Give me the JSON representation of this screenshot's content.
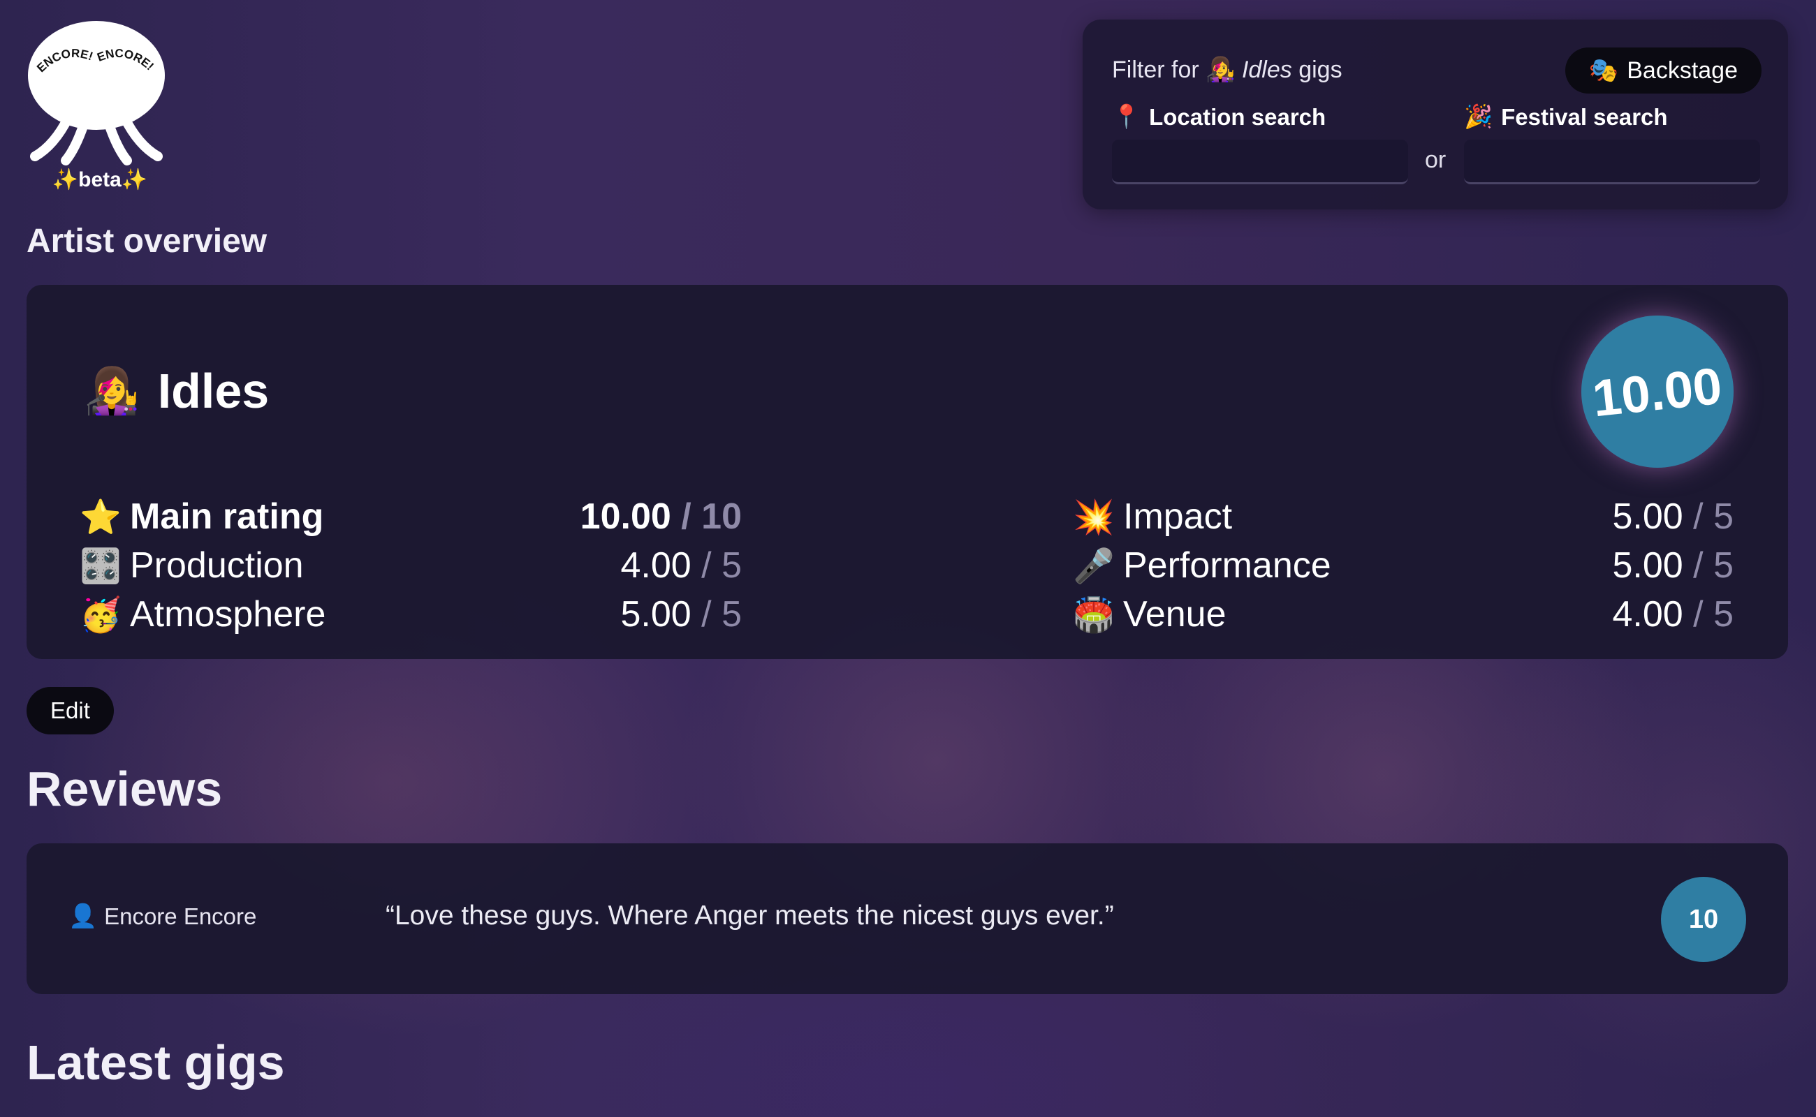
{
  "logo": {
    "arc_text_left": "ENCORE!",
    "arc_text_right": "ENCORE!",
    "beta_label": "beta",
    "beta_sparkle": "✨"
  },
  "filter": {
    "prefix": "Filter for",
    "artist_emoji": "👩‍🎤",
    "artist_name": "Idles",
    "suffix": "gigs",
    "backstage_emoji": "🎭",
    "backstage_label": "Backstage",
    "location_emoji": "📍",
    "location_label": "Location search",
    "location_value": "",
    "or_label": "or",
    "festival_emoji": "🎉",
    "festival_label": "Festival search",
    "festival_value": ""
  },
  "artist_overview": {
    "heading": "Artist overview",
    "artist_emoji": "👩‍🎤",
    "artist_name": "Idles",
    "overall_score": "10.00",
    "ratings_left": [
      {
        "emoji": "⭐",
        "label": "Main rating",
        "value": "10.00",
        "max": "/ 10"
      },
      {
        "emoji": "🎛️",
        "label": "Production",
        "value": "4.00",
        "max": "/ 5"
      },
      {
        "emoji": "🥳",
        "label": "Atmosphere",
        "value": "5.00",
        "max": "/ 5"
      }
    ],
    "ratings_right": [
      {
        "emoji": "💥",
        "label": "Impact",
        "value": "5.00",
        "max": "/ 5"
      },
      {
        "emoji": "🎤",
        "label": "Performance",
        "value": "5.00",
        "max": "/ 5"
      },
      {
        "emoji": "🏟️",
        "label": "Venue",
        "value": "4.00",
        "max": "/ 5"
      }
    ]
  },
  "edit_label": "Edit",
  "reviews": {
    "heading": "Reviews",
    "items": [
      {
        "author_emoji": "👤",
        "author": "Encore Encore",
        "text": "“Love these guys. Where Anger meets the nicest guys ever.”",
        "score": "10"
      }
    ]
  },
  "latest_gigs": {
    "heading": "Latest gigs"
  },
  "colors": {
    "score_circle": "#2f7ea3",
    "card_bg": "#1b1830",
    "button_bg": "#0b0a12",
    "muted_text": "#8f8aa8"
  }
}
